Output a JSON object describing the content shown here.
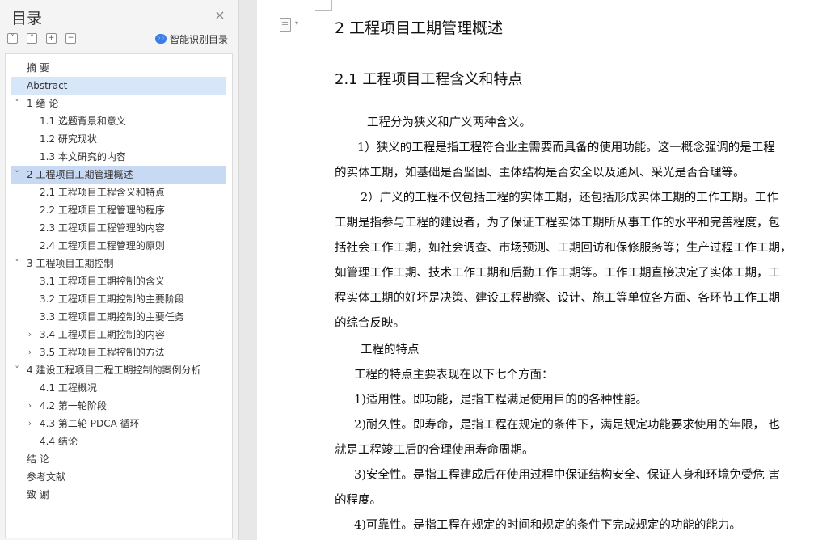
{
  "toc": {
    "title": "目录",
    "close_glyph": "×",
    "smart_label": "智能识别目录",
    "items": [
      {
        "label": "摘  要"
      },
      {
        "label": "Abstract"
      },
      {
        "label": "1 绪  论"
      },
      {
        "label": "1.1 选题背景和意义"
      },
      {
        "label": "1.2 研究现状"
      },
      {
        "label": "1.3 本文研究的内容"
      },
      {
        "label": "2 工程项目工期管理概述"
      },
      {
        "label": "2.1 工程项目工程含义和特点"
      },
      {
        "label": "2.2 工程项目工程管理的程序"
      },
      {
        "label": "2.3 工程项目工程管理的内容"
      },
      {
        "label": "2.4 工程项目工程管理的原则"
      },
      {
        "label": "3 工程项目工期控制"
      },
      {
        "label": "3.1 工程项目工期控制的含义"
      },
      {
        "label": "3.2 工程项目工期控制的主要阶段"
      },
      {
        "label": "3.3 工程项目工期控制的主要任务"
      },
      {
        "label": "3.4 工程项目工期控制的内容"
      },
      {
        "label": "3.5 工程项目工程控制的方法"
      },
      {
        "label": "4 建设工程项目工程工期控制的案例分析"
      },
      {
        "label": "4.1 工程概况"
      },
      {
        "label": "4.2 第一轮阶段"
      },
      {
        "label": "4.3 第二轮 PDCA 循环"
      },
      {
        "label": "4.4 结论"
      },
      {
        "label": "结  论"
      },
      {
        "label": "参考文献"
      },
      {
        "label": "致  谢"
      }
    ]
  },
  "document": {
    "heading1": "2 工程项目工期管理概述",
    "heading2": "2.1 工程项目工程含义和特点",
    "lines": [
      "工程分为狭义和广义两种含义。",
      "1）狭义的工程是指工程符合业主需要而具备的使用功能。这一概念强调的是工程",
      "的实体工期，如基础是否坚固、主体结构是否安全以及通风、采光是否合理等。",
      "2）广义的工程不仅包括工程的实体工期，还包括形成实体工期的工作工期。工作",
      "工期是指参与工程的建设者，为了保证工程实体工期所从事工作的水平和完善程度，包",
      "括社会工作工期，如社会调查、市场预测、工期回访和保修服务等；生产过程工作工期，",
      "如管理工作工期、技术工作工期和后勤工作工期等。工作工期直接决定了实体工期，工",
      "程实体工期的好坏是决策、建设工程勘察、设计、施工等单位各方面、各环节工作工期",
      "的综合反映。",
      "工程的特点",
      "工程的特点主要表现在以下七个方面：",
      "1)适用性。即功能，是指工程满足使用目的的各种性能。",
      "2)耐久性。即寿命，是指工程在规定的条件下，满足规定功能要求使用的年限，  也",
      "就是工程竣工后的合理使用寿命周期。",
      "3)安全性。是指工程建成后在使用过程中保证结构安全、保证人身和环境免受危  害",
      "的程度。",
      "4)可靠性。是指工程在规定的时间和规定的条件下完成规定的功能的能力。"
    ]
  }
}
